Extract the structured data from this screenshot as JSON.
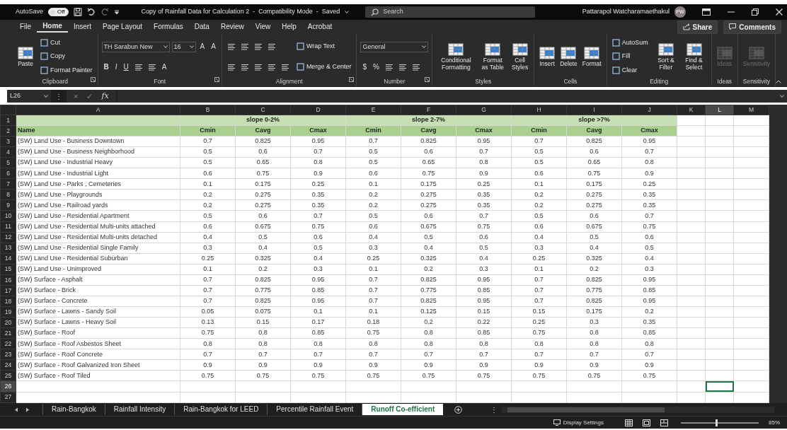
{
  "title_bar": {
    "autosave_label": "AutoSave",
    "autosave": {
      "label": "Off",
      "on": false
    },
    "title": "Copy of Rainfall Data for Calculation 2  -  Compatibility Mode  -  Saved",
    "search_placeholder": "Search",
    "user": "Pattarapol Watcharamaethakul",
    "avatar": "PW"
  },
  "menu": [
    {
      "label": "File",
      "selected": false
    },
    {
      "label": "Home",
      "selected": true
    },
    {
      "label": "Insert",
      "selected": false
    },
    {
      "label": "Page Layout",
      "selected": false
    },
    {
      "label": "Formulas",
      "selected": false
    },
    {
      "label": "Data",
      "selected": false
    },
    {
      "label": "Review",
      "selected": false
    },
    {
      "label": "View",
      "selected": false
    },
    {
      "label": "Help",
      "selected": false
    },
    {
      "label": "Acrobat",
      "selected": false
    }
  ],
  "share": "Share",
  "comments": "Comments",
  "ribbon": [
    {
      "label": "Clipboard",
      "launcher": true,
      "cols": [
        [
          [
            {
              "kind": "large",
              "label": "Paste",
              "disabled": false
            }
          ]
        ],
        [
          [
            {
              "kind": "small",
              "label": "Cut"
            }
          ],
          [
            {
              "kind": "small",
              "label": "Copy"
            }
          ],
          [
            {
              "kind": "small",
              "label": "Format Painter"
            }
          ]
        ]
      ]
    },
    {
      "label": "Font",
      "launcher": true,
      "cols": [
        [
          [
            {
              "kind": "field",
              "value": "TH Sarabun New"
            },
            {
              "kind": "field",
              "value": "16"
            },
            {
              "kind": "glyph",
              "label": "A"
            },
            {
              "kind": "glyph",
              "label": "A"
            }
          ],
          [
            {
              "kind": "glyph",
              "label": "B"
            },
            {
              "kind": "glyph",
              "label": "I"
            },
            {
              "kind": "glyph",
              "label": "U"
            },
            {
              "kind": "icon"
            },
            {
              "kind": "icon"
            },
            {
              "kind": "glyph",
              "label": "A"
            }
          ]
        ]
      ]
    },
    {
      "label": "Alignment",
      "launcher": true,
      "cols": [
        [
          [
            {
              "kind": "icon"
            },
            {
              "kind": "icon"
            },
            {
              "kind": "icon"
            },
            {
              "kind": "icon"
            }
          ],
          [
            {
              "kind": "icon"
            },
            {
              "kind": "icon"
            },
            {
              "kind": "icon"
            },
            {
              "kind": "icon"
            },
            {
              "kind": "icon"
            }
          ]
        ],
        [
          [
            {
              "kind": "small",
              "label": "Wrap Text"
            }
          ],
          [
            {
              "kind": "small",
              "label": "Merge & Center"
            }
          ]
        ]
      ]
    },
    {
      "label": "Number",
      "launcher": true,
      "cols": [
        [
          [
            {
              "kind": "field",
              "value": "General"
            }
          ],
          [
            {
              "kind": "glyph",
              "label": "$"
            },
            {
              "kind": "glyph",
              "label": "%"
            },
            {
              "kind": "icon"
            },
            {
              "kind": "icon"
            },
            {
              "kind": "icon"
            }
          ]
        ]
      ]
    },
    {
      "label": "Styles",
      "launcher": false,
      "cols": [
        [
          [
            {
              "kind": "large",
              "label": "Conditional Formatting",
              "disabled": false
            },
            {
              "kind": "large",
              "label": "Format as Table",
              "disabled": false
            },
            {
              "kind": "large",
              "label": "Cell Styles",
              "disabled": false
            }
          ]
        ]
      ]
    },
    {
      "label": "Cells",
      "launcher": false,
      "cols": [
        [
          [
            {
              "kind": "large",
              "label": "Insert",
              "disabled": false
            },
            {
              "kind": "large",
              "label": "Delete",
              "disabled": false
            },
            {
              "kind": "large",
              "label": "Format",
              "disabled": false
            }
          ]
        ]
      ]
    },
    {
      "label": "Editing",
      "launcher": false,
      "cols": [
        [
          [
            {
              "kind": "small",
              "label": "AutoSum"
            }
          ],
          [
            {
              "kind": "small",
              "label": "Fill"
            }
          ],
          [
            {
              "kind": "small",
              "label": "Clear"
            }
          ]
        ],
        [
          [
            {
              "kind": "large",
              "label": "Sort & Filter",
              "disabled": false
            },
            {
              "kind": "large",
              "label": "Find & Select",
              "disabled": false
            }
          ]
        ]
      ]
    },
    {
      "label": "Ideas",
      "launcher": false,
      "cols": [
        [
          [
            {
              "kind": "large",
              "label": "Ideas",
              "disabled": true
            }
          ]
        ]
      ]
    },
    {
      "label": "Sensitivity",
      "launcher": false,
      "cols": [
        [
          [
            {
              "kind": "large",
              "label": "Sensitivity",
              "disabled": true
            }
          ]
        ]
      ]
    }
  ],
  "formula_bar": {
    "name_box": "L26",
    "more": "⋮",
    "cancel": "×",
    "enter": "✓",
    "fx": "fx"
  },
  "sheet": {
    "column_letters": [
      {
        "label": "A",
        "selected": false
      },
      {
        "label": "B",
        "selected": false
      },
      {
        "label": "C",
        "selected": false
      },
      {
        "label": "D",
        "selected": false
      },
      {
        "label": "E",
        "selected": false
      },
      {
        "label": "F",
        "selected": false
      },
      {
        "label": "G",
        "selected": false
      },
      {
        "label": "H",
        "selected": false
      },
      {
        "label": "I",
        "selected": false
      },
      {
        "label": "J",
        "selected": false
      },
      {
        "label": "K",
        "selected": false
      },
      {
        "label": "L",
        "selected": true
      },
      {
        "label": "M",
        "selected": false
      }
    ],
    "row_numbers": [
      {
        "label": "1",
        "selected": false
      },
      {
        "label": "2",
        "selected": false
      },
      {
        "label": "3",
        "selected": false
      },
      {
        "label": "4",
        "selected": false
      },
      {
        "label": "5",
        "selected": false
      },
      {
        "label": "6",
        "selected": false
      },
      {
        "label": "7",
        "selected": false
      },
      {
        "label": "8",
        "selected": false
      },
      {
        "label": "9",
        "selected": false
      },
      {
        "label": "10",
        "selected": false
      },
      {
        "label": "11",
        "selected": false
      },
      {
        "label": "12",
        "selected": false
      },
      {
        "label": "13",
        "selected": false
      },
      {
        "label": "14",
        "selected": false
      },
      {
        "label": "15",
        "selected": false
      },
      {
        "label": "16",
        "selected": false
      },
      {
        "label": "17",
        "selected": false
      },
      {
        "label": "18",
        "selected": false
      },
      {
        "label": "19",
        "selected": false
      },
      {
        "label": "20",
        "selected": false
      },
      {
        "label": "21",
        "selected": false
      },
      {
        "label": "22",
        "selected": false
      },
      {
        "label": "23",
        "selected": false
      },
      {
        "label": "24",
        "selected": false
      },
      {
        "label": "25",
        "selected": false
      },
      {
        "label": "26",
        "selected": true
      },
      {
        "label": "27",
        "selected": false
      }
    ],
    "group_headers": [
      "slope 0-2%",
      "slope 2-7%",
      "slope >7%"
    ],
    "columns": [
      "Name",
      "Cmin",
      "Cavg",
      "Cmax",
      "Cmin",
      "Cavg",
      "Cmax",
      "Cmin",
      "Cavg",
      "Cmax"
    ],
    "rows": [
      {
        "name": "(SW) Land Use - Business Downtown",
        "values": [
          "0.7",
          "0.825",
          "0.95",
          "0.7",
          "0.825",
          "0.95",
          "0.7",
          "0.825",
          "0.95"
        ]
      },
      {
        "name": "(SW) Land Use - Business Neighborhood",
        "values": [
          "0.5",
          "0.6",
          "0.7",
          "0.5",
          "0.6",
          "0.7",
          "0.5",
          "0.6",
          "0.7"
        ]
      },
      {
        "name": "(SW) Land Use - Industrial Heavy",
        "values": [
          "0.5",
          "0.65",
          "0.8",
          "0.5",
          "0.65",
          "0.8",
          "0.5",
          "0.65",
          "0.8"
        ]
      },
      {
        "name": "(SW) Land Use - Industrial Light",
        "values": [
          "0.6",
          "0.75",
          "0.9",
          "0.6",
          "0.75",
          "0.9",
          "0.6",
          "0.75",
          "0.9"
        ]
      },
      {
        "name": "(SW) Land Use - Parks , Cemeteries",
        "values": [
          "0.1",
          "0.175",
          "0.25",
          "0.1",
          "0.175",
          "0.25",
          "0.1",
          "0.175",
          "0.25"
        ]
      },
      {
        "name": "(SW) Land Use - Playgrounds",
        "values": [
          "0.2",
          "0.275",
          "0.35",
          "0.2",
          "0.275",
          "0.35",
          "0.2",
          "0.275",
          "0.35"
        ]
      },
      {
        "name": "(SW) Land Use - Railroad yards",
        "values": [
          "0.2",
          "0.275",
          "0.35",
          "0.2",
          "0.275",
          "0.35",
          "0.2",
          "0.275",
          "0.35"
        ]
      },
      {
        "name": "(SW) Land Use - Residential Apartment",
        "values": [
          "0.5",
          "0.6",
          "0.7",
          "0.5",
          "0.6",
          "0.7",
          "0.5",
          "0.6",
          "0.7"
        ]
      },
      {
        "name": "(SW) Land Use - Residential Multi-units attached",
        "values": [
          "0.6",
          "0.675",
          "0.75",
          "0.6",
          "0.675",
          "0.75",
          "0.6",
          "0.675",
          "0.75"
        ]
      },
      {
        "name": "(SW) Land Use - Residential Multi-units detached",
        "values": [
          "0.4",
          "0.5",
          "0.6",
          "0.4",
          "0.5",
          "0.6",
          "0.4",
          "0.5",
          "0.6"
        ]
      },
      {
        "name": "(SW) Land Use - Residential Single Family",
        "values": [
          "0.3",
          "0.4",
          "0.5",
          "0.3",
          "0.4",
          "0.5",
          "0.3",
          "0.4",
          "0.5"
        ]
      },
      {
        "name": "(SW) Land Use - Residential Suburban",
        "values": [
          "0.25",
          "0.325",
          "0.4",
          "0.25",
          "0.325",
          "0.4",
          "0.25",
          "0.325",
          "0.4"
        ]
      },
      {
        "name": "(SW) Land Use - Unimproved",
        "values": [
          "0.1",
          "0.2",
          "0.3",
          "0.1",
          "0.2",
          "0.3",
          "0.1",
          "0.2",
          "0.3"
        ]
      },
      {
        "name": "(SW) Surface - Asphalt",
        "values": [
          "0.7",
          "0.825",
          "0.95",
          "0.7",
          "0.825",
          "0.95",
          "0.7",
          "0.825",
          "0.95"
        ]
      },
      {
        "name": "(SW) Surface - Brick",
        "values": [
          "0.7",
          "0.775",
          "0.85",
          "0.7",
          "0.775",
          "0.85",
          "0.7",
          "0.775",
          "0.85"
        ]
      },
      {
        "name": "(SW) Surface - Concrete",
        "values": [
          "0.7",
          "0.825",
          "0.95",
          "0.7",
          "0.825",
          "0.95",
          "0.7",
          "0.825",
          "0.95"
        ]
      },
      {
        "name": "(SW) Surface - Lawns - Sandy Soil",
        "values": [
          "0.05",
          "0.075",
          "0.1",
          "0.1",
          "0.125",
          "0.15",
          "0.15",
          "0.175",
          "0.2"
        ]
      },
      {
        "name": "(SW) Surface - Lawns - Heavy Soil",
        "values": [
          "0.13",
          "0.15",
          "0.17",
          "0.18",
          "0.2",
          "0.22",
          "0.25",
          "0.3",
          "0.35"
        ]
      },
      {
        "name": "(SW) Surface - Roof",
        "values": [
          "0.75",
          "0.8",
          "0.85",
          "0.75",
          "0.8",
          "0.85",
          "0.75",
          "0.8",
          "0.85"
        ]
      },
      {
        "name": "(SW) Surface - Roof Asbestos Sheet",
        "values": [
          "0.8",
          "0.8",
          "0.8",
          "0.8",
          "0.8",
          "0.8",
          "0.8",
          "0.8",
          "0.8"
        ]
      },
      {
        "name": "(SW) Surface - Roof Concrete",
        "values": [
          "0.7",
          "0.7",
          "0.7",
          "0.7",
          "0.7",
          "0.7",
          "0.7",
          "0.7",
          "0.7"
        ]
      },
      {
        "name": "(SW) Surface - Roof Galvanized Iron Sheet",
        "values": [
          "0.9",
          "0.9",
          "0.9",
          "0.9",
          "0.9",
          "0.9",
          "0.9",
          "0.9",
          "0.9"
        ]
      },
      {
        "name": "(SW) Surface - Roof Tiled",
        "values": [
          "0.75",
          "0.75",
          "0.75",
          "0.75",
          "0.75",
          "0.75",
          "0.75",
          "0.75",
          "0.75"
        ]
      }
    ]
  },
  "sheet_tabs": [
    {
      "label": "Rain-Bangkok",
      "selected": false
    },
    {
      "label": "Rainfall Intensity",
      "selected": false
    },
    {
      "label": "Rain-Bangkok for LEED",
      "selected": false
    },
    {
      "label": "Percentile Rainfall Event",
      "selected": false
    },
    {
      "label": "Runoff Co-efficient",
      "selected": true
    }
  ],
  "tab_more": "⋮",
  "status_bar": {
    "display_settings": "Display Settings",
    "zoom": "85%",
    "zoom_slider": {
      "level": 0.45
    }
  }
}
